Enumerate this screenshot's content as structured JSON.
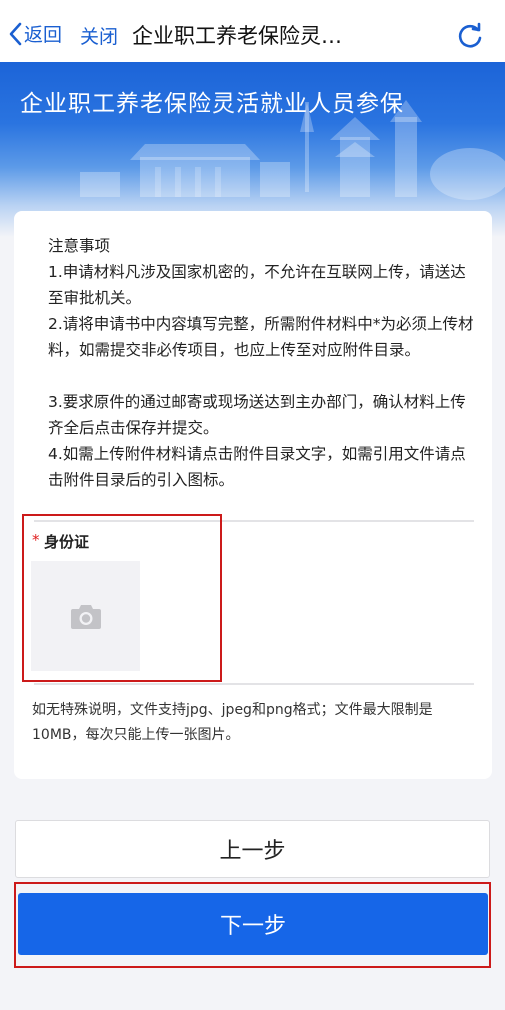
{
  "navbar": {
    "back_label": "返回",
    "close_label": "关闭",
    "title": "企业职工养老保险灵…"
  },
  "banner": {
    "title": "企业职工养老保险灵活就业人员参保"
  },
  "notes": {
    "title": "注意事项",
    "items": [
      "1.申请材料凡涉及国家机密的，不允许在互联网上传，请送达至审批机关。",
      "2.请将申请书中内容填写完整，所需附件材料中*为必须上传材料，如需提交非必传项目，也应上传至对应附件目录。",
      "3.要求原件的通过邮寄或现场送达到主办部门，确认材料上传齐全后点击保存并提交。",
      "4.如需上传附件材料请点击附件目录文字，如需引用文件请点击附件目录后的引入图标。"
    ]
  },
  "attachment": {
    "required_mark": "*",
    "label": "身份证",
    "upload_icon": "camera-icon"
  },
  "upload_hint": "如无特殊说明，文件支持jpg、jpeg和png格式；文件最大限制是10MB，每次只能上传一张图片。",
  "buttons": {
    "prev_label": "上一步",
    "next_label": "下一步"
  },
  "colors": {
    "accent": "#1666e8",
    "nav_text": "#1a5fd1",
    "highlight": "#cc1a1a",
    "required": "#e02020"
  }
}
